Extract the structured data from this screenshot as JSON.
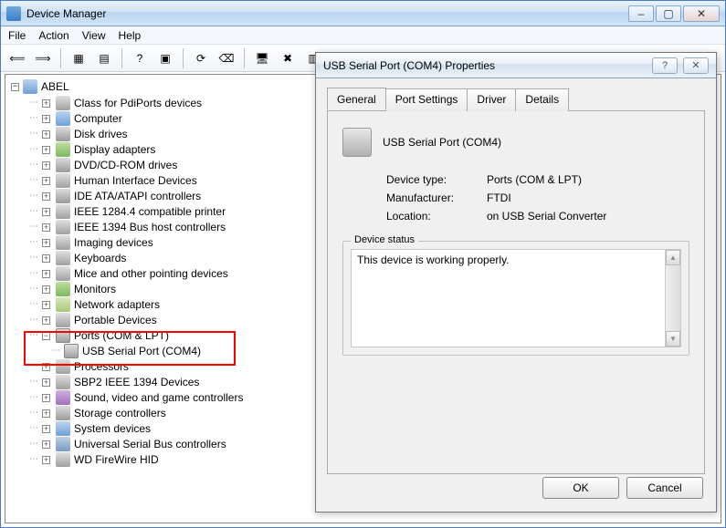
{
  "window": {
    "title": "Device Manager",
    "menu": [
      "File",
      "Action",
      "View",
      "Help"
    ]
  },
  "tree": {
    "root": "ABEL",
    "items": [
      {
        "label": "Class for PdiPorts devices",
        "icon": "generic"
      },
      {
        "label": "Computer",
        "icon": "computer"
      },
      {
        "label": "Disk drives",
        "icon": "drive"
      },
      {
        "label": "Display adapters",
        "icon": "monitor"
      },
      {
        "label": "DVD/CD-ROM drives",
        "icon": "drive"
      },
      {
        "label": "Human Interface Devices",
        "icon": "generic"
      },
      {
        "label": "IDE ATA/ATAPI controllers",
        "icon": "drive"
      },
      {
        "label": "IEEE 1284.4 compatible printer",
        "icon": "generic"
      },
      {
        "label": "IEEE 1394 Bus host controllers",
        "icon": "generic"
      },
      {
        "label": "Imaging devices",
        "icon": "generic"
      },
      {
        "label": "Keyboards",
        "icon": "generic"
      },
      {
        "label": "Mice and other pointing devices",
        "icon": "generic"
      },
      {
        "label": "Monitors",
        "icon": "monitor"
      },
      {
        "label": "Network adapters",
        "icon": "network"
      },
      {
        "label": "Portable Devices",
        "icon": "generic"
      },
      {
        "label": "Ports (COM & LPT)",
        "icon": "port",
        "expanded": true,
        "children": [
          {
            "label": "USB Serial Port (COM4)",
            "icon": "port"
          }
        ]
      },
      {
        "label": "Processors",
        "icon": "generic"
      },
      {
        "label": "SBP2 IEEE 1394 Devices",
        "icon": "generic"
      },
      {
        "label": "Sound, video and game controllers",
        "icon": "sound"
      },
      {
        "label": "Storage controllers",
        "icon": "drive"
      },
      {
        "label": "System devices",
        "icon": "computer"
      },
      {
        "label": "Universal Serial Bus controllers",
        "icon": "usb"
      },
      {
        "label": "WD FireWire HID",
        "icon": "generic"
      }
    ]
  },
  "dialog": {
    "title": "USB Serial Port (COM4) Properties",
    "tabs": [
      "General",
      "Port Settings",
      "Driver",
      "Details"
    ],
    "active_tab": "General",
    "device_name": "USB Serial Port (COM4)",
    "rows": {
      "type_label": "Device type:",
      "type_value": "Ports (COM & LPT)",
      "mfr_label": "Manufacturer:",
      "mfr_value": "FTDI",
      "loc_label": "Location:",
      "loc_value": "on USB Serial Converter"
    },
    "status_label": "Device status",
    "status_text": "This device is working properly.",
    "ok": "OK",
    "cancel": "Cancel"
  }
}
